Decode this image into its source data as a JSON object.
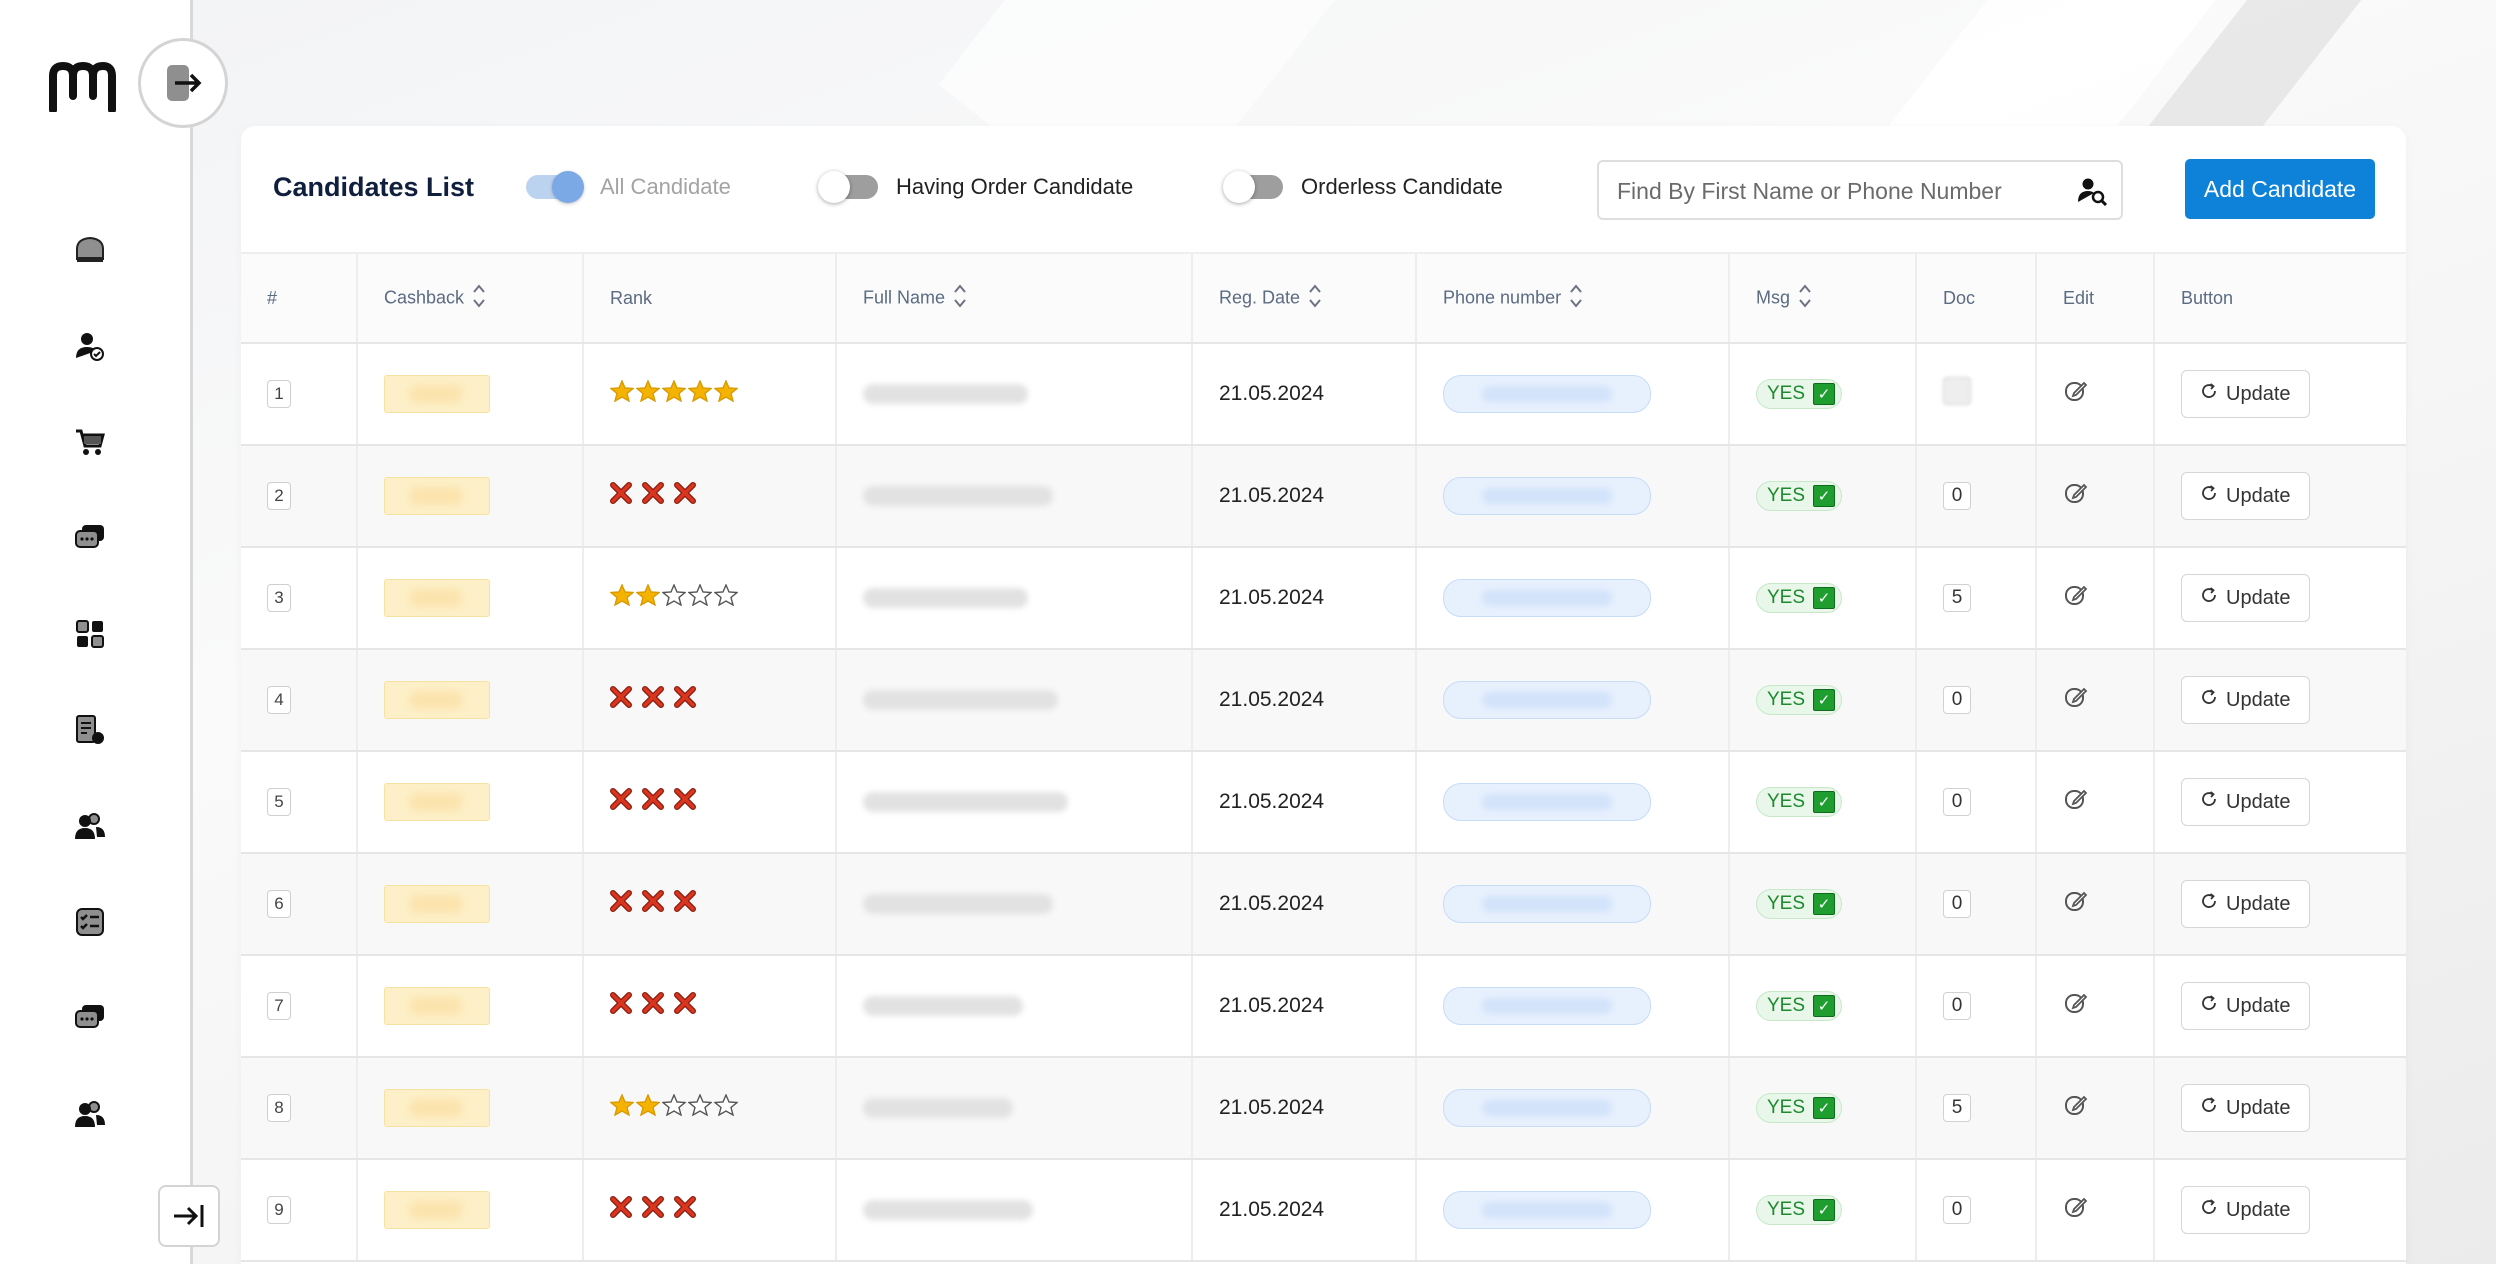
{
  "sidebar": {
    "logo": "logo-mark",
    "nav_icons": [
      "home-icon",
      "user-check-icon",
      "cart-icon",
      "chat-icon",
      "grid-icon",
      "document-icon",
      "users-icon",
      "checklist-icon",
      "chat-icon",
      "users-icon"
    ]
  },
  "toolbar": {
    "title": "Candidates List",
    "toggles": [
      {
        "label": "All Candidate",
        "on": true
      },
      {
        "label": "Having Order Candidate",
        "on": false
      },
      {
        "label": "Orderless Candidate",
        "on": false
      }
    ],
    "search_placeholder": "Find By First Name or Phone Number",
    "add_label": "Add Candidate"
  },
  "table": {
    "headers": [
      "#",
      "Cashback",
      "Rank",
      "Full Name",
      "Reg. Date",
      "Phone number",
      "Msg",
      "Doc",
      "Edit",
      "Button"
    ],
    "rows": [
      {
        "index": "1",
        "rank": "stars",
        "stars": 5,
        "date": "21.05.2024",
        "msg": "YES",
        "doc": "",
        "update": "Update"
      },
      {
        "index": "2",
        "rank": "x",
        "stars": 0,
        "date": "21.05.2024",
        "msg": "YES",
        "doc": "0",
        "update": "Update"
      },
      {
        "index": "3",
        "rank": "stars",
        "stars": 2,
        "date": "21.05.2024",
        "msg": "YES",
        "doc": "5",
        "update": "Update"
      },
      {
        "index": "4",
        "rank": "x",
        "stars": 0,
        "date": "21.05.2024",
        "msg": "YES",
        "doc": "0",
        "update": "Update"
      },
      {
        "index": "5",
        "rank": "x",
        "stars": 0,
        "date": "21.05.2024",
        "msg": "YES",
        "doc": "0",
        "update": "Update"
      },
      {
        "index": "6",
        "rank": "x",
        "stars": 0,
        "date": "21.05.2024",
        "msg": "YES",
        "doc": "0",
        "update": "Update"
      },
      {
        "index": "7",
        "rank": "x",
        "stars": 0,
        "date": "21.05.2024",
        "msg": "YES",
        "doc": "0",
        "update": "Update"
      },
      {
        "index": "8",
        "rank": "stars",
        "stars": 2,
        "date": "21.05.2024",
        "msg": "YES",
        "doc": "5",
        "update": "Update"
      },
      {
        "index": "9",
        "rank": "x",
        "stars": 0,
        "date": "21.05.2024",
        "msg": "YES",
        "doc": "0",
        "update": "Update"
      }
    ]
  },
  "colors": {
    "accent": "#0d82d8",
    "star": "#f5b301",
    "cross": "#d9361e",
    "yes": "#1e8a2e"
  }
}
